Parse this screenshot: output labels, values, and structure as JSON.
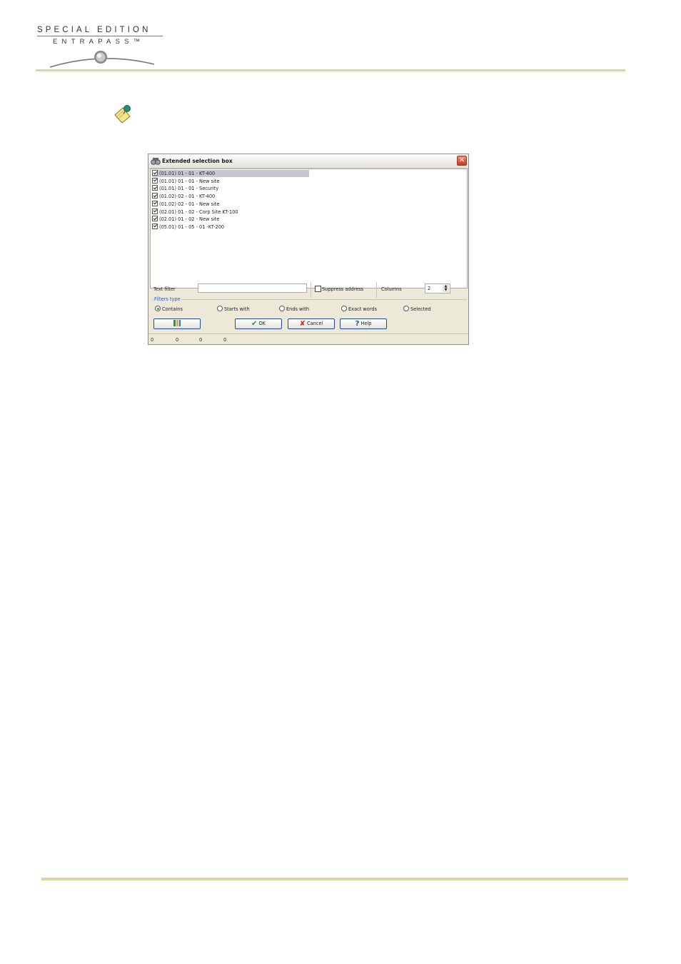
{
  "brand": {
    "line1": "SPECIAL EDITION",
    "line2": "ENTRAPASS™"
  },
  "icons": {
    "note": "note-pin-icon",
    "dialog": "search-binoculars-icon",
    "close": "close-icon",
    "first_button": "columns-icon",
    "ok": "checkmark-icon",
    "cancel": "x-icon",
    "help": "question-icon"
  },
  "dialog": {
    "title": "Extended selection box",
    "close_glyph": "✕",
    "items": [
      {
        "label": "(01.01) 01 - 01 - KT-400",
        "checked": true,
        "selected": true
      },
      {
        "label": "(01.01) 01 - 01 - New site",
        "checked": true,
        "selected": false
      },
      {
        "label": "(01.01) 01 - 01 - Security",
        "checked": true,
        "selected": false
      },
      {
        "label": "(01.02) 02 - 01 - KT-400",
        "checked": true,
        "selected": false
      },
      {
        "label": "(01.02) 02 - 01 - New site",
        "checked": true,
        "selected": false
      },
      {
        "label": "(02.01) 01 - 02 - Corp Site KT-100",
        "checked": true,
        "selected": false
      },
      {
        "label": "(02.01) 01 - 02 - New site",
        "checked": true,
        "selected": false
      },
      {
        "label": "(05.01) 01 - 05 - 01 -KT-200",
        "checked": true,
        "selected": false
      }
    ],
    "text_filter_label": "Text filter",
    "text_filter_value": "",
    "suppress_address_label": "Suppress address",
    "suppress_address_checked": false,
    "columns_label": "Columns",
    "columns_value": "2",
    "filters_type_label": "Filters type",
    "filters": [
      {
        "label": "Contains",
        "selected": true
      },
      {
        "label": "Starts with",
        "selected": false
      },
      {
        "label": "Ends with",
        "selected": false
      },
      {
        "label": "Exact words",
        "selected": false
      },
      {
        "label": "Selected",
        "selected": false
      }
    ],
    "buttons": {
      "ok": "OK",
      "cancel": "Cancel",
      "help": "Help",
      "ok_glyph": "✔",
      "cancel_glyph": "✘",
      "help_glyph": "?"
    },
    "status": [
      "0",
      "0",
      "0",
      "0"
    ]
  },
  "colors": {
    "accent_rule": "#dcd6a4",
    "button_border": "#2b4a93",
    "filters_legend": "#2f55c8"
  }
}
